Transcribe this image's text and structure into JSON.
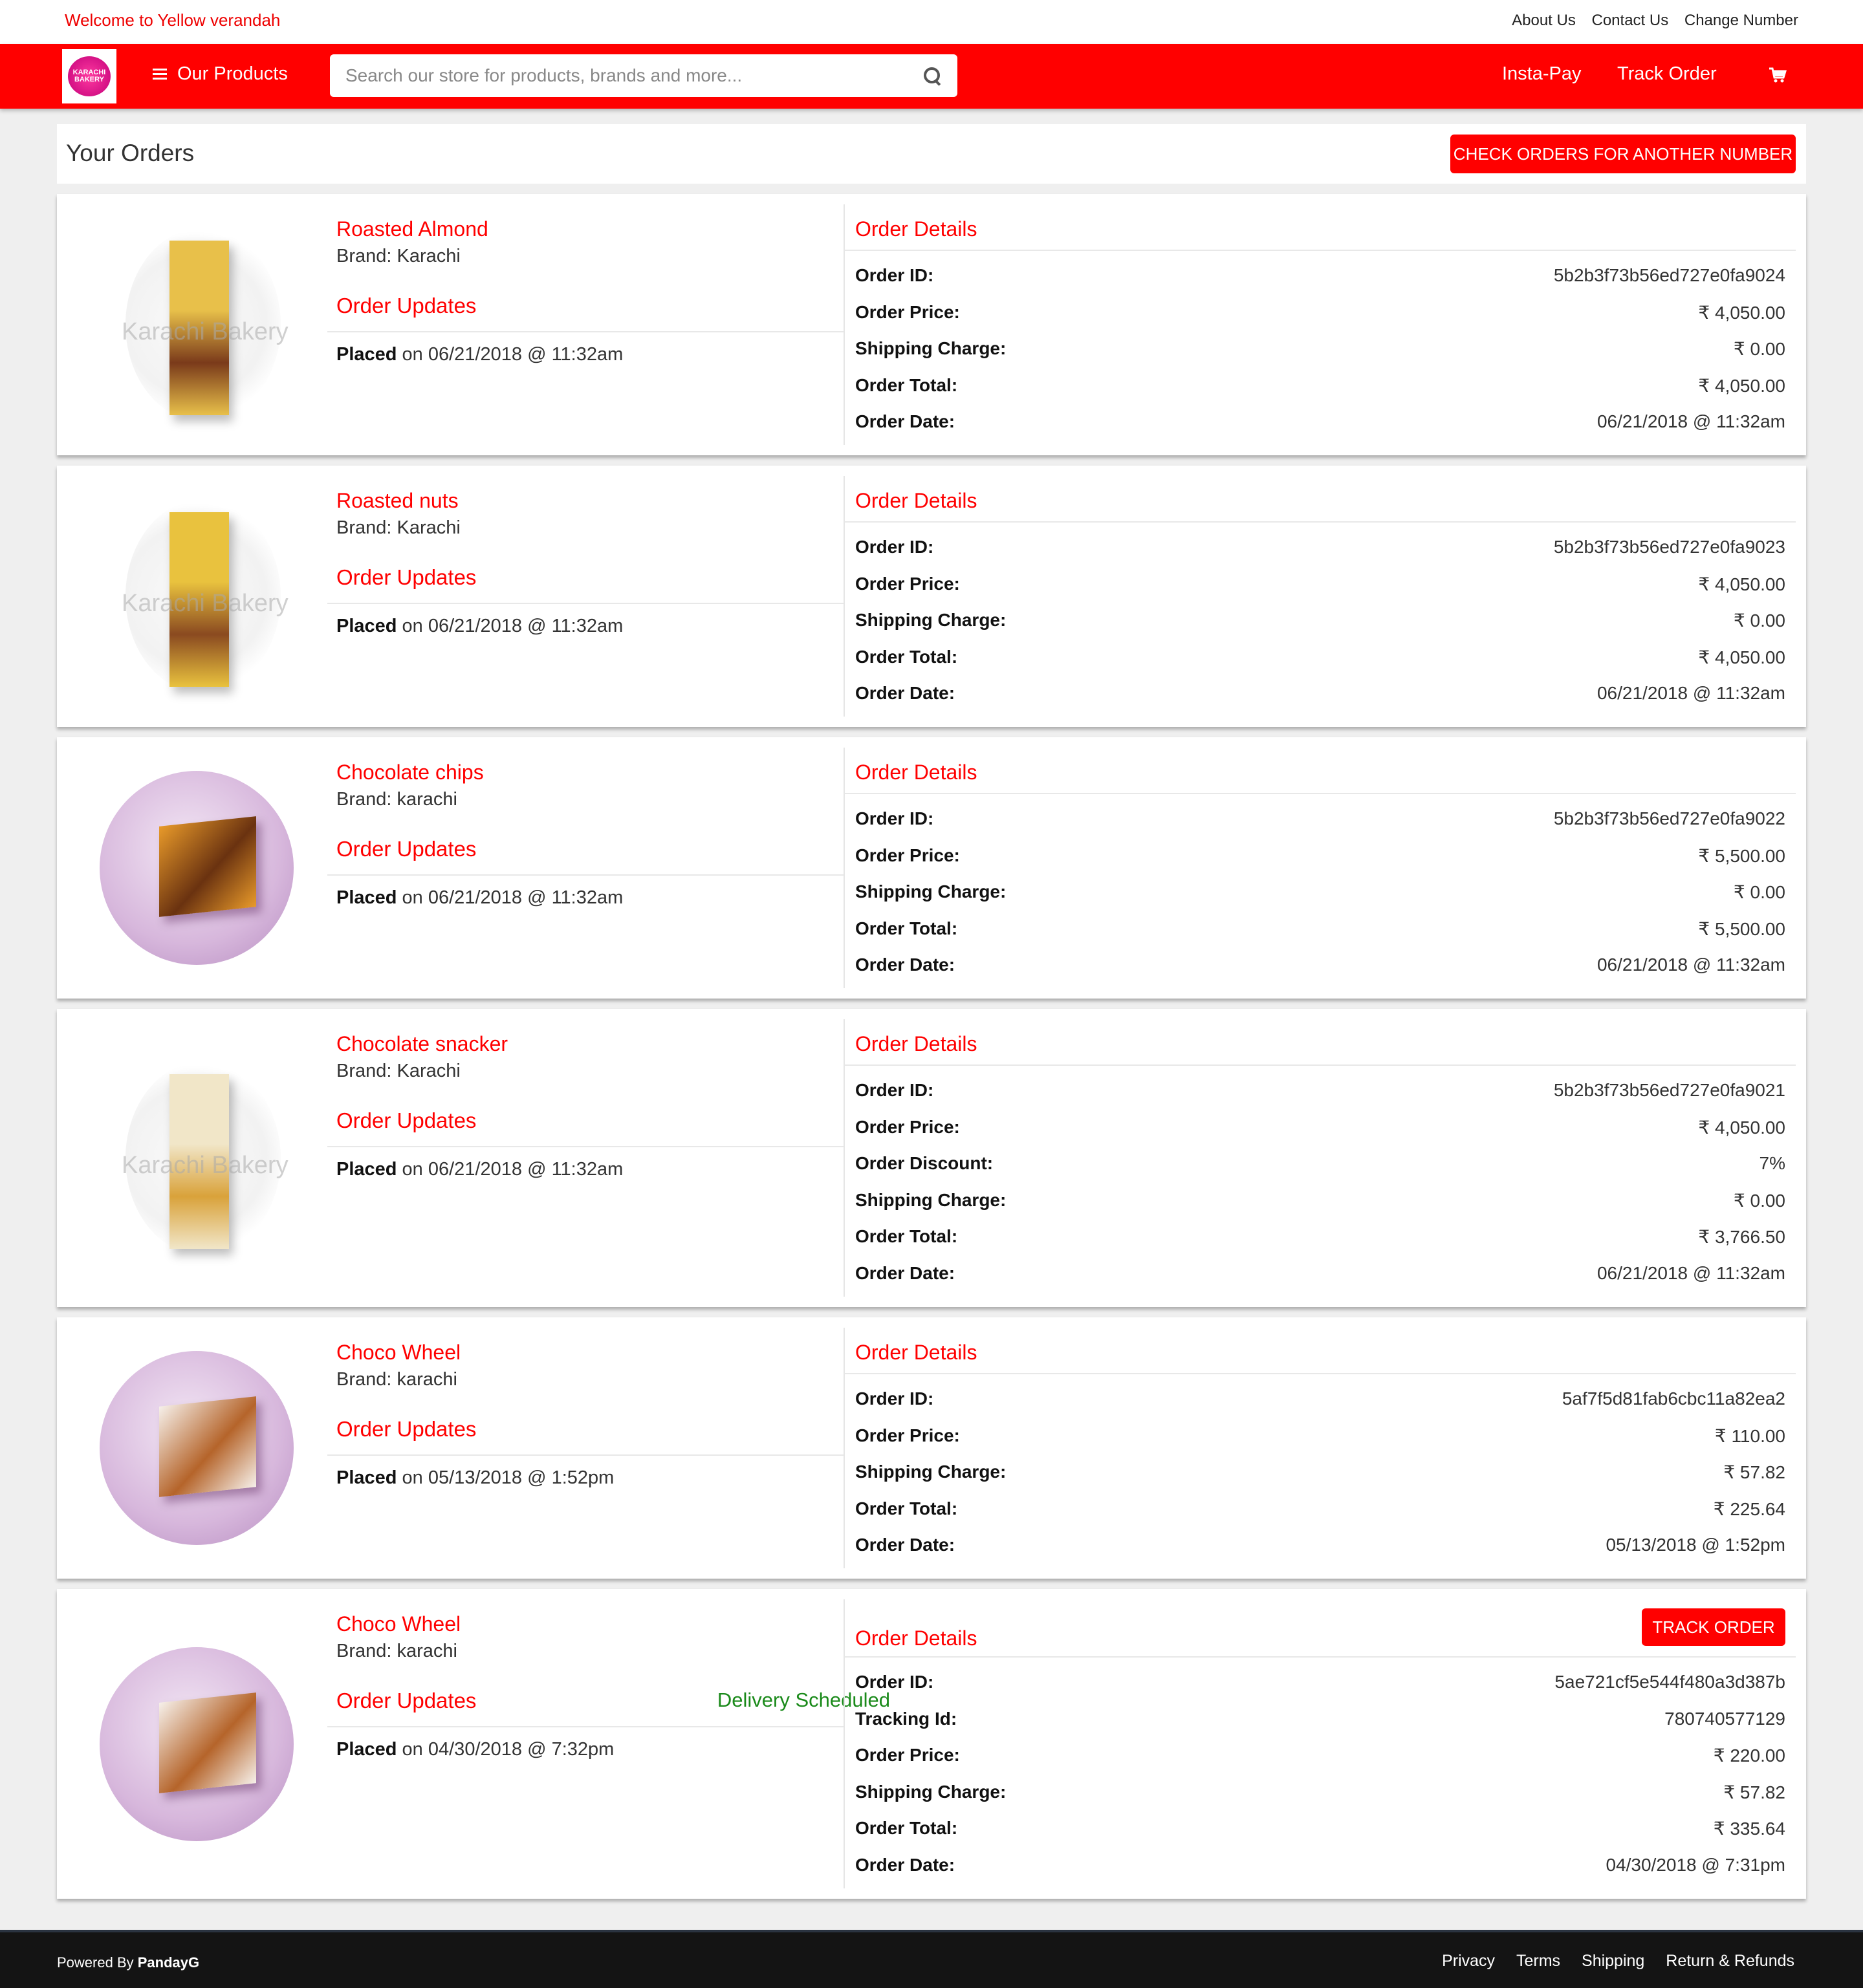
{
  "topbar": {
    "welcome": "Welcome to Yellow verandah",
    "links": [
      "About Us",
      "Contact Us",
      "Change Number"
    ]
  },
  "nav": {
    "logo_text": "KARACHI BAKERY",
    "menu_label": "Our Products",
    "search_placeholder": "Search our store for products, brands and more...",
    "links": [
      "Insta-Pay",
      "Track Order"
    ],
    "cart_icon": "cart-icon",
    "search_icon": "search-icon"
  },
  "page": {
    "title": "Your Orders",
    "check_button": "CHECK ORDERS FOR ANOTHER NUMBER"
  },
  "labels": {
    "order_updates": "Order Updates",
    "order_details": "Order Details",
    "placed": "Placed",
    "watermark": "Karachi Bakery",
    "track_button": "TRACK ORDER"
  },
  "orders": [
    {
      "name": "Roasted Almond",
      "brand": "Brand: Karachi",
      "status": "",
      "placed_on": " on 06/21/2018 @ 11:32am",
      "image": "tall",
      "box_colors": [
        "#e8c04a",
        "#7a3a1a"
      ],
      "details": [
        {
          "k": "Order ID:",
          "v": "5b2b3f73b56ed727e0fa9024"
        },
        {
          "k": "Order Price:",
          "v": "₹ 4,050.00"
        },
        {
          "k": "Shipping Charge:",
          "v": "₹ 0.00"
        },
        {
          "k": "Order Total:",
          "v": "₹ 4,050.00"
        },
        {
          "k": "Order Date:",
          "v": "06/21/2018 @ 11:32am"
        }
      ]
    },
    {
      "name": "Roasted nuts",
      "brand": "Brand: Karachi",
      "status": "",
      "placed_on": " on 06/21/2018 @ 11:32am",
      "image": "tall",
      "box_colors": [
        "#e9c23e",
        "#8a4a20"
      ],
      "details": [
        {
          "k": "Order ID:",
          "v": "5b2b3f73b56ed727e0fa9023"
        },
        {
          "k": "Order Price:",
          "v": "₹ 4,050.00"
        },
        {
          "k": "Shipping Charge:",
          "v": "₹ 0.00"
        },
        {
          "k": "Order Total:",
          "v": "₹ 4,050.00"
        },
        {
          "k": "Order Date:",
          "v": "06/21/2018 @ 11:32am"
        }
      ]
    },
    {
      "name": "Chocolate chips",
      "brand": "Brand: karachi",
      "status": "",
      "placed_on": " on 06/21/2018 @ 11:32am",
      "image": "round",
      "box_colors": [
        "#e89a2a",
        "#6a3210"
      ],
      "details": [
        {
          "k": "Order ID:",
          "v": "5b2b3f73b56ed727e0fa9022"
        },
        {
          "k": "Order Price:",
          "v": "₹ 5,500.00"
        },
        {
          "k": "Shipping Charge:",
          "v": "₹ 0.00"
        },
        {
          "k": "Order Total:",
          "v": "₹ 5,500.00"
        },
        {
          "k": "Order Date:",
          "v": "06/21/2018 @ 11:32am"
        }
      ]
    },
    {
      "name": "Chocolate snacker",
      "brand": "Brand: Karachi",
      "status": "",
      "placed_on": " on 06/21/2018 @ 11:32am",
      "image": "tall",
      "box_colors": [
        "#f1e6c8",
        "#d9a23a"
      ],
      "details": [
        {
          "k": "Order ID:",
          "v": "5b2b3f73b56ed727e0fa9021"
        },
        {
          "k": "Order Price:",
          "v": "₹ 4,050.00"
        },
        {
          "k": "Order Discount:",
          "v": "7%"
        },
        {
          "k": "Shipping Charge:",
          "v": "₹ 0.00"
        },
        {
          "k": "Order Total:",
          "v": "₹ 3,766.50"
        },
        {
          "k": "Order Date:",
          "v": "06/21/2018 @ 11:32am"
        }
      ]
    },
    {
      "name": "Choco Wheel",
      "brand": "Brand: karachi",
      "status": "",
      "placed_on": " on 05/13/2018 @ 1:52pm",
      "image": "round",
      "box_colors": [
        "#f6f0ea",
        "#b5642a"
      ],
      "details": [
        {
          "k": "Order ID:",
          "v": "5af7f5d81fab6cbc11a82ea2"
        },
        {
          "k": "Order Price:",
          "v": "₹ 110.00"
        },
        {
          "k": "Shipping Charge:",
          "v": "₹ 57.82"
        },
        {
          "k": "Order Total:",
          "v": "₹ 225.64"
        },
        {
          "k": "Order Date:",
          "v": "05/13/2018 @ 1:52pm"
        }
      ]
    },
    {
      "name": "Choco Wheel",
      "brand": "Brand: karachi",
      "status": "Delivery Scheduled",
      "placed_on": " on 04/30/2018 @ 7:32pm",
      "image": "round",
      "box_colors": [
        "#f6f0ea",
        "#b5642a"
      ],
      "track": true,
      "details": [
        {
          "k": "Order ID:",
          "v": "5ae721cf5e544f480a3d387b"
        },
        {
          "k": "Tracking Id:",
          "v": "780740577129"
        },
        {
          "k": "Order Price:",
          "v": "₹ 220.00"
        },
        {
          "k": "Shipping Charge:",
          "v": "₹ 57.82"
        },
        {
          "k": "Order Total:",
          "v": "₹ 335.64"
        },
        {
          "k": "Order Date:",
          "v": "04/30/2018 @ 7:31pm"
        }
      ]
    }
  ],
  "footer": {
    "powered_prefix": "Powered By ",
    "powered_name": "PandayG",
    "links": [
      "Privacy",
      "Terms",
      "Shipping",
      "Return & Refunds"
    ]
  },
  "colors": {
    "brand_red": "#ff0000",
    "status_green": "#1a8a1a",
    "footer_bg": "#141414"
  }
}
